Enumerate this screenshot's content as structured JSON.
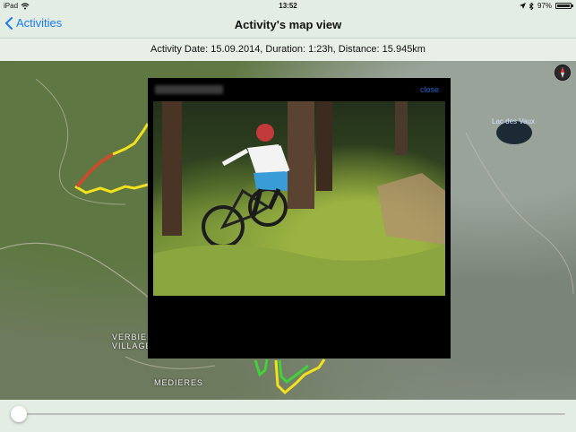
{
  "status_bar": {
    "device": "iPad",
    "time": "13:52",
    "battery_percent": "97%",
    "battery_level": 0.97
  },
  "navbar": {
    "back_label": "Activities",
    "title": "Activity's map view"
  },
  "info": {
    "text": "Activity Date: 15.09.2014, Duration: 1:23h, Distance: 15.945km"
  },
  "map": {
    "labels": {
      "village_line1": "VERBIER",
      "village_line2": "VILLAGE",
      "medieres": "MEDIERES",
      "lake": "Lac des Vaux"
    }
  },
  "popup": {
    "close_label": "close"
  },
  "slider": {
    "value": 0.0
  },
  "colors": {
    "accent": "#1a7bf2",
    "route_yellow": "#f2e21e",
    "route_red": "#d24a2b",
    "route_green": "#3fd23a"
  }
}
